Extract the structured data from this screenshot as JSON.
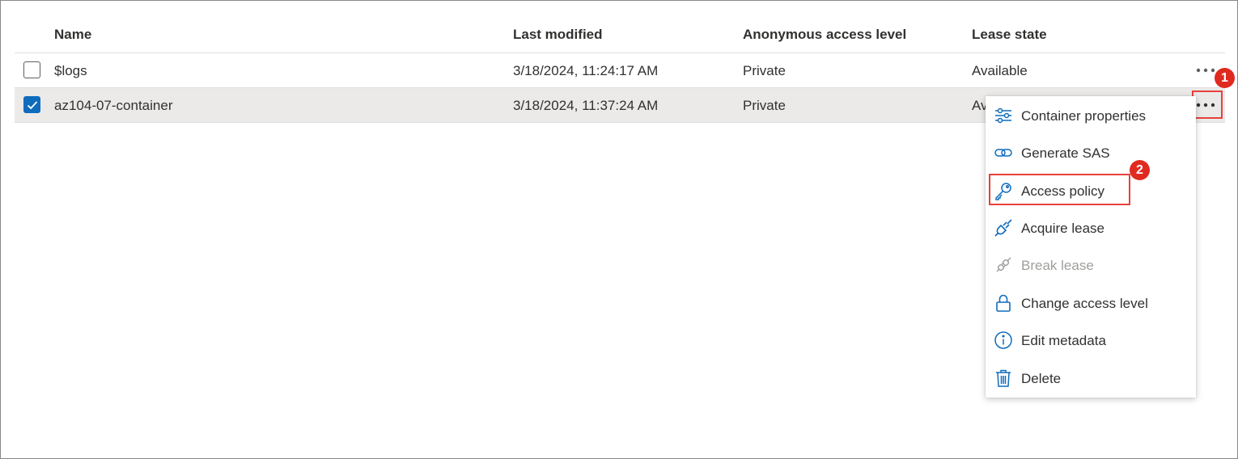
{
  "table": {
    "columns": [
      "Name",
      "Last modified",
      "Anonymous access level",
      "Lease state"
    ],
    "rows": [
      {
        "name": "$logs",
        "last_modified": "3/18/2024, 11:24:17 AM",
        "access_level": "Private",
        "lease_state": "Available",
        "selected": false
      },
      {
        "name": "az104-07-container",
        "last_modified": "3/18/2024, 11:37:24 AM",
        "access_level": "Private",
        "lease_state": "Av",
        "selected": true
      }
    ]
  },
  "context_menu": {
    "items": [
      {
        "label": "Container properties",
        "icon": "sliders-icon",
        "enabled": true
      },
      {
        "label": "Generate SAS",
        "icon": "link-icon",
        "enabled": true
      },
      {
        "label": "Access policy",
        "icon": "key-icon",
        "enabled": true
      },
      {
        "label": "Acquire lease",
        "icon": "plug-icon",
        "enabled": true
      },
      {
        "label": "Break lease",
        "icon": "broken-plug-icon",
        "enabled": false
      },
      {
        "label": "Change access level",
        "icon": "lock-icon",
        "enabled": true
      },
      {
        "label": "Edit metadata",
        "icon": "info-icon",
        "enabled": true
      },
      {
        "label": "Delete",
        "icon": "trash-icon",
        "enabled": true
      }
    ]
  },
  "annotations": {
    "step1": "1",
    "step2": "2"
  },
  "colors": {
    "accent": "#0f6cbd",
    "highlight": "#e8413c",
    "badge": "#e02a20",
    "selected_row": "#ebeae9"
  }
}
